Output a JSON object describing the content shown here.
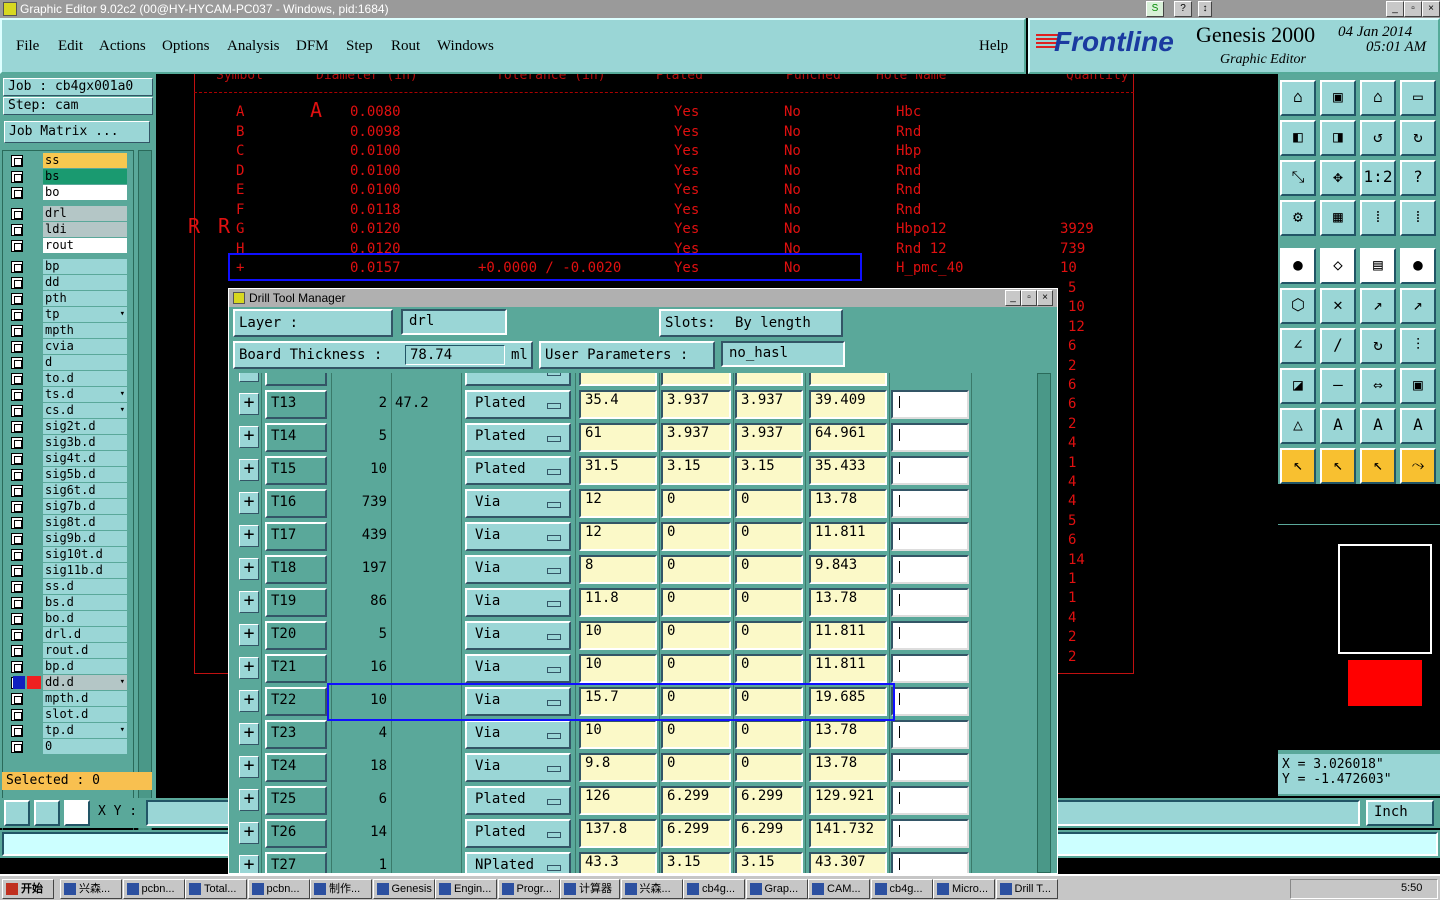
{
  "window": {
    "title": "Graphic Editor 9.02c2 (00@HY-HYCAM-PC037 - Windows, pid:1684)"
  },
  "menu": [
    "File",
    "Edit",
    "Actions",
    "Options",
    "Analysis",
    "DFM",
    "Step",
    "Rout",
    "Windows"
  ],
  "help": "Help",
  "brand": {
    "logo": "Frontline",
    "product": "Genesis 2000",
    "subtitle": "Graphic Editor",
    "date": "04 Jan 2014",
    "time": "05:01 AM"
  },
  "left": {
    "job": "Job  : cb4gx001a0",
    "step": "Step: cam",
    "job_matrix": "Job Matrix ...",
    "layers_top": [
      {
        "name": "ss",
        "style": "ss"
      },
      {
        "name": "bs",
        "style": "bs"
      },
      {
        "name": "bo",
        "style": "bo"
      }
    ],
    "layers_mid": [
      {
        "name": "drl",
        "style": "gray"
      },
      {
        "name": "ldi",
        "style": "gray"
      },
      {
        "name": "rout",
        "style": "gray2"
      }
    ],
    "layers": [
      {
        "name": "bp",
        "mark": false
      },
      {
        "name": "dd",
        "mark": false
      },
      {
        "name": "pth",
        "mark": false
      },
      {
        "name": "tp",
        "mark": true
      },
      {
        "name": "mpth",
        "mark": false
      },
      {
        "name": "cvia",
        "mark": false
      },
      {
        "name": "d",
        "mark": false
      },
      {
        "name": "to.d",
        "mark": false
      },
      {
        "name": "ts.d",
        "mark": true
      },
      {
        "name": "cs.d",
        "mark": true
      },
      {
        "name": "sig2t.d",
        "mark": false
      },
      {
        "name": "sig3b.d",
        "mark": false
      },
      {
        "name": "sig4t.d",
        "mark": false
      },
      {
        "name": "sig5b.d",
        "mark": false
      },
      {
        "name": "sig6t.d",
        "mark": false
      },
      {
        "name": "sig7b.d",
        "mark": false
      },
      {
        "name": "sig8t.d",
        "mark": false
      },
      {
        "name": "sig9b.d",
        "mark": false
      },
      {
        "name": "sig10t.d",
        "mark": false
      },
      {
        "name": "sig11b.d",
        "mark": false
      },
      {
        "name": "ss.d",
        "mark": false
      },
      {
        "name": "bs.d",
        "mark": false
      },
      {
        "name": "bo.d",
        "mark": false
      },
      {
        "name": "drl.d",
        "mark": false
      },
      {
        "name": "rout.d",
        "mark": false
      },
      {
        "name": "bp.d",
        "mark": false
      },
      {
        "name": "dd.d",
        "mark": true
      },
      {
        "name": "mpth.d",
        "mark": false
      },
      {
        "name": "slot.d",
        "mark": false
      },
      {
        "name": "tp.d",
        "mark": true
      },
      {
        "name": "0",
        "mark": false
      }
    ],
    "selected": "Selected : 0"
  },
  "canvas": {
    "header": [
      "Symbol",
      "Diameter (in)",
      "Tolerance (in)",
      "Plated",
      "Punched",
      "Hole Name",
      "Quantity"
    ],
    "rows": [
      {
        "sym": "A",
        "dia": "0.0080",
        "tol": "",
        "plated": "Yes",
        "punched": "No",
        "name": "Hbc",
        "qty": ""
      },
      {
        "sym": "B",
        "dia": "0.0098",
        "tol": "",
        "plated": "Yes",
        "punched": "No",
        "name": "Rnd",
        "qty": ""
      },
      {
        "sym": "C",
        "dia": "0.0100",
        "tol": "",
        "plated": "Yes",
        "punched": "No",
        "name": "Hbp",
        "qty": ""
      },
      {
        "sym": "D",
        "dia": "0.0100",
        "tol": "",
        "plated": "Yes",
        "punched": "No",
        "name": "Rnd",
        "qty": ""
      },
      {
        "sym": "E",
        "dia": "0.0100",
        "tol": "",
        "plated": "Yes",
        "punched": "No",
        "name": "Rnd",
        "qty": ""
      },
      {
        "sym": "F",
        "dia": "0.0118",
        "tol": "",
        "plated": "Yes",
        "punched": "No",
        "name": "Rnd",
        "qty": ""
      },
      {
        "sym": "G",
        "dia": "0.0120",
        "tol": "",
        "plated": "Yes",
        "punched": "No",
        "name": "Hbpo12",
        "qty": "3929"
      },
      {
        "sym": "H",
        "dia": "0.0120",
        "tol": "",
        "plated": "Yes",
        "punched": "No",
        "name": "Rnd 12",
        "qty": "739"
      },
      {
        "sym": "+",
        "dia": "0.0157",
        "tol": "+0.0000 / -0.0020",
        "plated": "Yes",
        "punched": "No",
        "name": "H_pmc_40",
        "qty": "10"
      }
    ],
    "more_qty": [
      "5",
      "10",
      "12",
      "6",
      "2",
      "6",
      "6",
      "2",
      "4",
      "1",
      "4",
      "4",
      "5",
      "6",
      "14",
      "1",
      "1",
      "4",
      "2",
      "2"
    ]
  },
  "dialog": {
    "title": "Drill Tool Manager",
    "layer_label": "Layer          :",
    "layer_value": "drl",
    "slots_label": "Slots:",
    "slots_value": "By length",
    "thickness_label": "Board Thickness  :",
    "thickness_value": "78.74",
    "thickness_unit": "ml",
    "user_params_label": "User Parameters :",
    "user_params_value": "no_hasl",
    "tools": [
      {
        "name": "T13",
        "count": "2",
        "finish": "47.2",
        "type": "Plated",
        "d1": "35.4",
        "d2": "3.937",
        "d3": "3.937",
        "d4": "39.409"
      },
      {
        "name": "T14",
        "count": "5",
        "finish": "",
        "type": "Plated",
        "d1": "61",
        "d2": "3.937",
        "d3": "3.937",
        "d4": "64.961"
      },
      {
        "name": "T15",
        "count": "10",
        "finish": "",
        "type": "Plated",
        "d1": "31.5",
        "d2": "3.15",
        "d3": "3.15",
        "d4": "35.433"
      },
      {
        "name": "T16",
        "count": "739",
        "finish": "",
        "type": "Via",
        "d1": "12",
        "d2": "0",
        "d3": "0",
        "d4": "13.78"
      },
      {
        "name": "T17",
        "count": "439",
        "finish": "",
        "type": "Via",
        "d1": "12",
        "d2": "0",
        "d3": "0",
        "d4": "11.811"
      },
      {
        "name": "T18",
        "count": "197",
        "finish": "",
        "type": "Via",
        "d1": "8",
        "d2": "0",
        "d3": "0",
        "d4": "9.843"
      },
      {
        "name": "T19",
        "count": "86",
        "finish": "",
        "type": "Via",
        "d1": "11.8",
        "d2": "0",
        "d3": "0",
        "d4": "13.78"
      },
      {
        "name": "T20",
        "count": "5",
        "finish": "",
        "type": "Via",
        "d1": "10",
        "d2": "0",
        "d3": "0",
        "d4": "11.811"
      },
      {
        "name": "T21",
        "count": "16",
        "finish": "",
        "type": "Via",
        "d1": "10",
        "d2": "0",
        "d3": "0",
        "d4": "11.811"
      },
      {
        "name": "T22",
        "count": "10",
        "finish": "",
        "type": "Via",
        "d1": "15.7",
        "d2": "0",
        "d3": "0",
        "d4": "19.685"
      },
      {
        "name": "T23",
        "count": "4",
        "finish": "",
        "type": "Via",
        "d1": "10",
        "d2": "0",
        "d3": "0",
        "d4": "13.78"
      },
      {
        "name": "T24",
        "count": "18",
        "finish": "",
        "type": "Via",
        "d1": "9.8",
        "d2": "0",
        "d3": "0",
        "d4": "13.78"
      },
      {
        "name": "T25",
        "count": "6",
        "finish": "",
        "type": "Plated",
        "d1": "126",
        "d2": "6.299",
        "d3": "6.299",
        "d4": "129.921"
      },
      {
        "name": "T26",
        "count": "14",
        "finish": "",
        "type": "Plated",
        "d1": "137.8",
        "d2": "6.299",
        "d3": "6.299",
        "d4": "141.732"
      },
      {
        "name": "T27",
        "count": "1",
        "finish": "",
        "type": "NPlated",
        "d1": "43.3",
        "d2": "3.15",
        "d3": "3.15",
        "d4": "43.307"
      }
    ]
  },
  "right": {
    "x": "X = 3.026018\"",
    "y": "Y = -1.472603\"",
    "units": "Inch"
  },
  "coord": {
    "label": "X Y :"
  },
  "taskbar": {
    "start": "开始",
    "items": [
      "兴森...",
      "pcbn...",
      "Total...",
      "pcbn...",
      "制作...",
      "Genesis",
      "Engin...",
      "Progr...",
      "计算器",
      "兴森...",
      "cb4g...",
      "Grap...",
      "CAM...",
      "cb4g...",
      "Micro...",
      "Drill T..."
    ],
    "clock": "5:50"
  }
}
